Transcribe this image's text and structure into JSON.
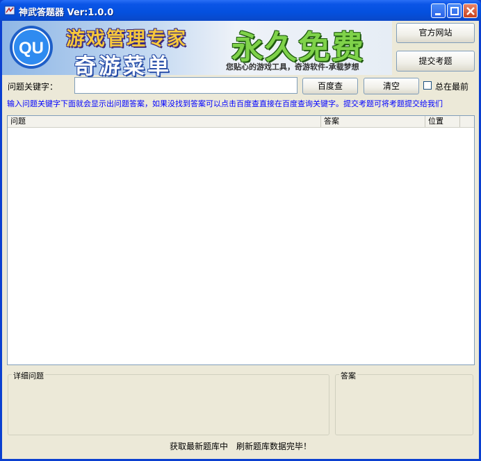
{
  "window": {
    "title": "神武答题器 Ver:1.0.0"
  },
  "banner": {
    "logo_text": "QU",
    "line1": "游戏管理专家",
    "line2": "奇游菜单",
    "free_text": "永久免费",
    "slogan": "您贴心的游戏工具，奇游软件-承载梦想"
  },
  "buttons": {
    "official_site": "官方网站",
    "submit_question": "提交考题",
    "baidu_search": "百度查",
    "clear": "清空"
  },
  "search": {
    "label": "问题关键字：",
    "value": ""
  },
  "always_on_top": {
    "label": "总在最前",
    "checked": false
  },
  "hint": "输入问题关键字下面就会显示出问题答案，如果没找到答案可以点击百度查直接在百度查询关键字。提交考题可将考题提交给我们",
  "list": {
    "columns": [
      "问题",
      "答案",
      "位置"
    ],
    "rows": []
  },
  "detail_group": {
    "label": "详细问题"
  },
  "answer_group": {
    "label": "答案"
  },
  "status": "获取最新题库中　刷新题库数据完毕！",
  "colors": {
    "titlebar": "#0450de",
    "hint_text": "#0000ff",
    "background": "#ece9d8"
  }
}
